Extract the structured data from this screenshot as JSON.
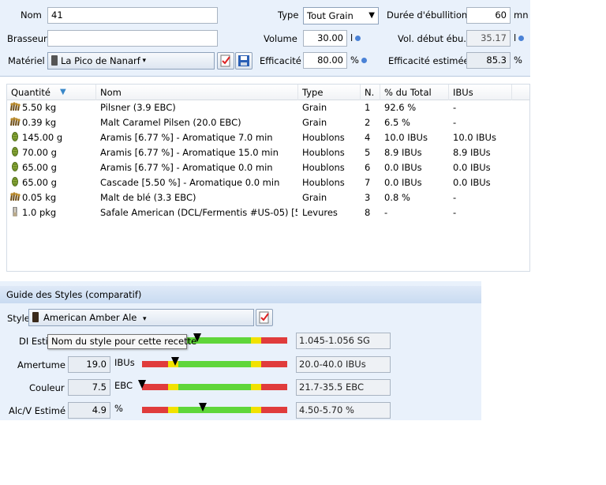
{
  "recipe": {
    "name_label": "Nom",
    "name_value": "41",
    "brewer_label": "Brasseur",
    "brewer_value": "",
    "equipment_label": "Matériel",
    "equipment_value": "La Pico de Nanarf",
    "type_label": "Type",
    "type_value": "Tout Grain",
    "volume_label": "Volume",
    "volume_value": "30.00",
    "volume_unit": "l",
    "efficiency_label": "Efficacité",
    "efficiency_value": "80.00",
    "efficiency_unit": "%",
    "boil_label": "Durée d'ébullition",
    "boil_value": "60",
    "boil_unit": "mn",
    "preboil_label": "Vol. début ébu.",
    "preboil_value": "35.17",
    "preboil_unit": "l",
    "est_eff_label": "Efficacité estimée",
    "est_eff_value": "85.3",
    "est_eff_unit": "%"
  },
  "table": {
    "headers": [
      "Quantité",
      "Nom",
      "Type",
      "N.",
      "% du Total",
      "IBUs"
    ],
    "rows": [
      {
        "icon": "grain",
        "qty": "5.50 kg",
        "name": "Pilsner  (3.9 EBC)",
        "type": "Grain",
        "n": "1",
        "pct": "92.6 %",
        "ibu": "-"
      },
      {
        "icon": "grain",
        "qty": "0.39 kg",
        "name": "Malt Caramel Pilsen (20.0 EBC)",
        "type": "Grain",
        "n": "2",
        "pct": "6.5 %",
        "ibu": "-"
      },
      {
        "icon": "hop",
        "qty": "145.00 g",
        "name": "Aramis [6.77 %] - Aromatique  7.0 min",
        "type": "Houblons",
        "n": "4",
        "pct": "10.0 IBUs",
        "ibu": "10.0 IBUs"
      },
      {
        "icon": "hop",
        "qty": "70.00 g",
        "name": "Aramis [6.77 %] - Aromatique  15.0 min",
        "type": "Houblons",
        "n": "5",
        "pct": "8.9 IBUs",
        "ibu": "8.9 IBUs"
      },
      {
        "icon": "hop",
        "qty": "65.00 g",
        "name": "Aramis [6.77 %] - Aromatique  0.0 min",
        "type": "Houblons",
        "n": "6",
        "pct": "0.0 IBUs",
        "ibu": "0.0 IBUs"
      },
      {
        "icon": "hop",
        "qty": "65.00 g",
        "name": "Cascade [5.50 %] - Aromatique  0.0 min",
        "type": "Houblons",
        "n": "7",
        "pct": "0.0 IBUs",
        "ibu": "0.0 IBUs"
      },
      {
        "icon": "grain",
        "qty": "0.05 kg",
        "name": "Malt de blé (3.3 EBC)",
        "type": "Grain",
        "n": "3",
        "pct": "0.8 %",
        "ibu": "-"
      },
      {
        "icon": "yeast",
        "qty": "1.0 pkg",
        "name": "Safale American  (DCL/Fermentis #US-05) [5...",
        "type": "Levures",
        "n": "8",
        "pct": "-",
        "ibu": "-"
      }
    ]
  },
  "style_guide": {
    "header": "Guide des Styles (comparatif)",
    "style_label": "Style",
    "style_value": "American Amber Ale",
    "tooltip": "Nom du style pour cette recette",
    "og_label": "DI Esti",
    "og_range": "1.045-1.056 SG",
    "og_level": 0.38,
    "ibu_label": "Amertume",
    "ibu_value": "19.0",
    "ibu_unit": "IBUs",
    "ibu_range": "20.0-40.0 IBUs",
    "ibu_level": 0.23,
    "color_label": "Couleur",
    "color_value": "7.5",
    "color_unit": "EBC",
    "color_range": "21.7-35.5 EBC",
    "color_level": 0.0,
    "abv_label": "Alc/V Estimé",
    "abv_value": "4.9",
    "abv_unit": "%",
    "abv_range": "4.50-5.70 %",
    "abv_level": 0.42
  },
  "colors": {
    "accent": "#4a82d6",
    "bar_red": "#e03c3c",
    "bar_yellow": "#f2e200",
    "bar_green": "#5fd63a"
  }
}
